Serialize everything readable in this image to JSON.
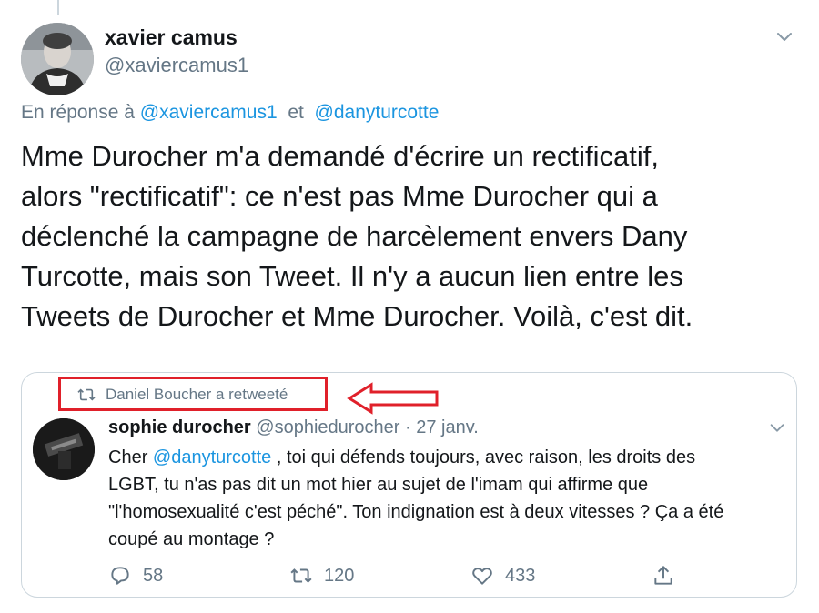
{
  "tweet": {
    "author_name": "xavier camus",
    "author_handle": "@xaviercamus1",
    "reply_prefix": "En réponse à",
    "reply_mention_1": "@xaviercamus1",
    "reply_joiner": "et",
    "reply_mention_2": "@danyturcotte",
    "text_lines": [
      "Mme Durocher m'a demandé d'écrire un rectificatif,",
      "alors \"rectificatif\": ce n'est pas Mme Durocher qui a",
      "déclenché la campagne de harcèlement envers Dany",
      "Turcotte, mais son Tweet. Il n'y a aucun lien entre les",
      "Tweets de Durocher et Mme Durocher. Voilà, c'est dit."
    ]
  },
  "quoted": {
    "retweet_context": "Daniel Boucher a retweeté",
    "author_name": "sophie durocher",
    "author_handle": "@sophiedurocher",
    "separator": "·",
    "date": "27 janv.",
    "text_line1_prefix": "Cher ",
    "text_line1_mention": "@danyturcotte",
    "text_line1_suffix": " , toi qui défends toujours, avec raison,  les droits des",
    "text_line2": "LGBT, tu n'as pas dit un mot hier au sujet de l'imam qui affirme que",
    "text_line3": "\"l'homosexualité c'est péché\". Ton indignation est à deux vitesses ? Ça a été",
    "text_line4": "coupé au montage ?",
    "replies": "58",
    "retweets": "120",
    "likes": "433"
  },
  "icons": {
    "caret": "chevron-down-icon",
    "reply": "reply-icon",
    "retweet": "retweet-icon",
    "like": "heart-icon",
    "share": "share-icon"
  },
  "colors": {
    "link": "#1b95e0",
    "muted": "#657786",
    "text": "#14171a",
    "annotation": "#e0202a"
  }
}
